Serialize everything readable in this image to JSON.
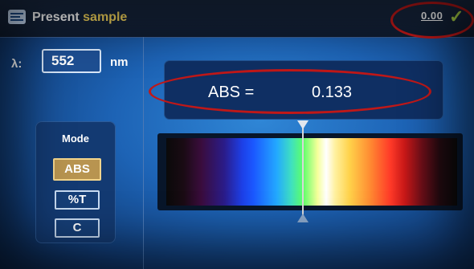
{
  "header": {
    "title_prefix": "Present",
    "title_accent": "sample",
    "zero_label": "0.00",
    "zero_check": "✓"
  },
  "wavelength": {
    "symbol": "λ:",
    "value": "552",
    "unit": "nm"
  },
  "mode": {
    "title": "Mode",
    "options": [
      "ABS",
      "%T",
      "C"
    ],
    "selected": "ABS"
  },
  "reading": {
    "label": "ABS =",
    "value": "0.133"
  },
  "icons": {
    "header": "sample-icon",
    "zero": "check-icon"
  },
  "colors": {
    "highlight_oval": "#c01818",
    "title_accent": "#f5d65c",
    "selected_mode": "#b89450",
    "check": "#b5e04a"
  }
}
